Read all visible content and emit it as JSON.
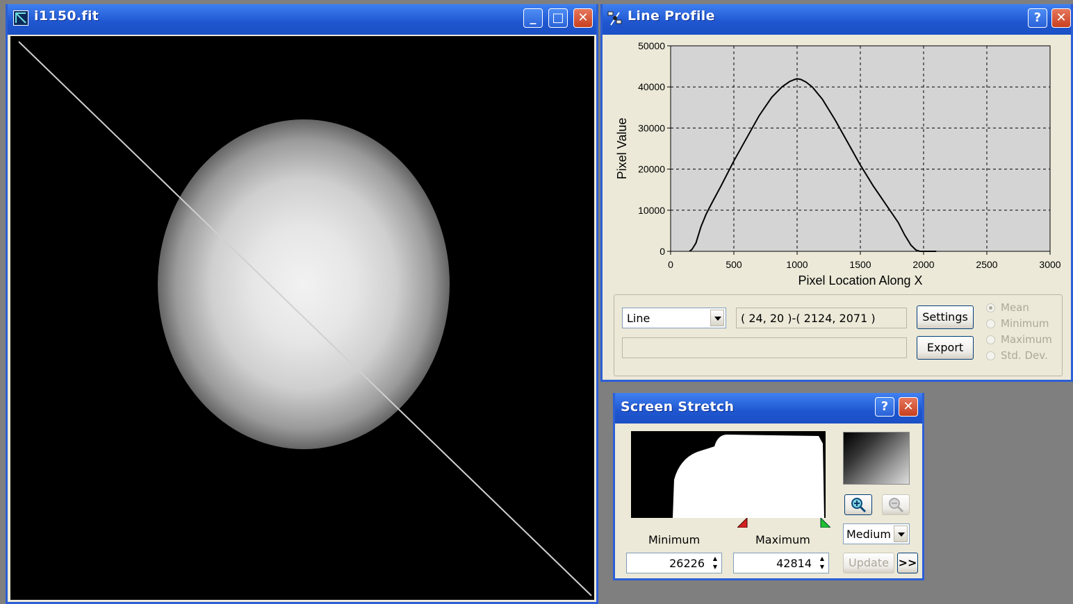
{
  "image_window": {
    "title": "i1150.fit",
    "buttons": {
      "minimize": "_",
      "maximize": "□",
      "close": "✕"
    }
  },
  "line_profile": {
    "title": "Line Profile",
    "help": "?",
    "close": "✕",
    "mode_value": "Line",
    "coords": "( 24, 20 )-( 2124, 2071 )",
    "status_text": "",
    "settings_label": "Settings",
    "export_label": "Export",
    "radio": [
      "Mean",
      "Minimum",
      "Maximum",
      "Std. Dev."
    ]
  },
  "chart_data": {
    "type": "line",
    "xlabel": "Pixel Location Along X",
    "ylabel": "Pixel Value",
    "xlim": [
      0,
      3000
    ],
    "ylim": [
      0,
      50000
    ],
    "xticks": [
      0,
      500,
      1000,
      1500,
      2000,
      2500,
      3000
    ],
    "yticks": [
      0,
      10000,
      20000,
      30000,
      40000,
      50000
    ],
    "grid": true,
    "series": [
      {
        "x": [
          150,
          170,
          200,
          240,
          280,
          330,
          400,
          500,
          600,
          700,
          800,
          880,
          940,
          980,
          1000,
          1030,
          1070,
          1120,
          1200,
          1300,
          1400,
          1500,
          1600,
          1700,
          1800,
          1850,
          1900,
          1940,
          1970,
          2000,
          2050,
          2100
        ],
        "y": [
          0,
          500,
          2000,
          6000,
          9000,
          12000,
          16000,
          22000,
          27500,
          33000,
          37500,
          40000,
          41300,
          41800,
          42000,
          41800,
          41200,
          40000,
          37000,
          32000,
          26500,
          21000,
          16000,
          11500,
          7000,
          4000,
          1500,
          300,
          0,
          0,
          0,
          0
        ]
      }
    ]
  },
  "screen_stretch": {
    "title": "Screen Stretch",
    "help": "?",
    "close": "✕",
    "minimum_label": "Minimum",
    "maximum_label": "Maximum",
    "minimum_value": "26226",
    "maximum_value": "42814",
    "quality_value": "Medium",
    "update_label": "Update",
    "more_label": ">>"
  },
  "colors": {
    "title_blue": "#1f56cf",
    "chart_bg": "#d4d4d4",
    "dialog_bg": "#ece9d8"
  }
}
